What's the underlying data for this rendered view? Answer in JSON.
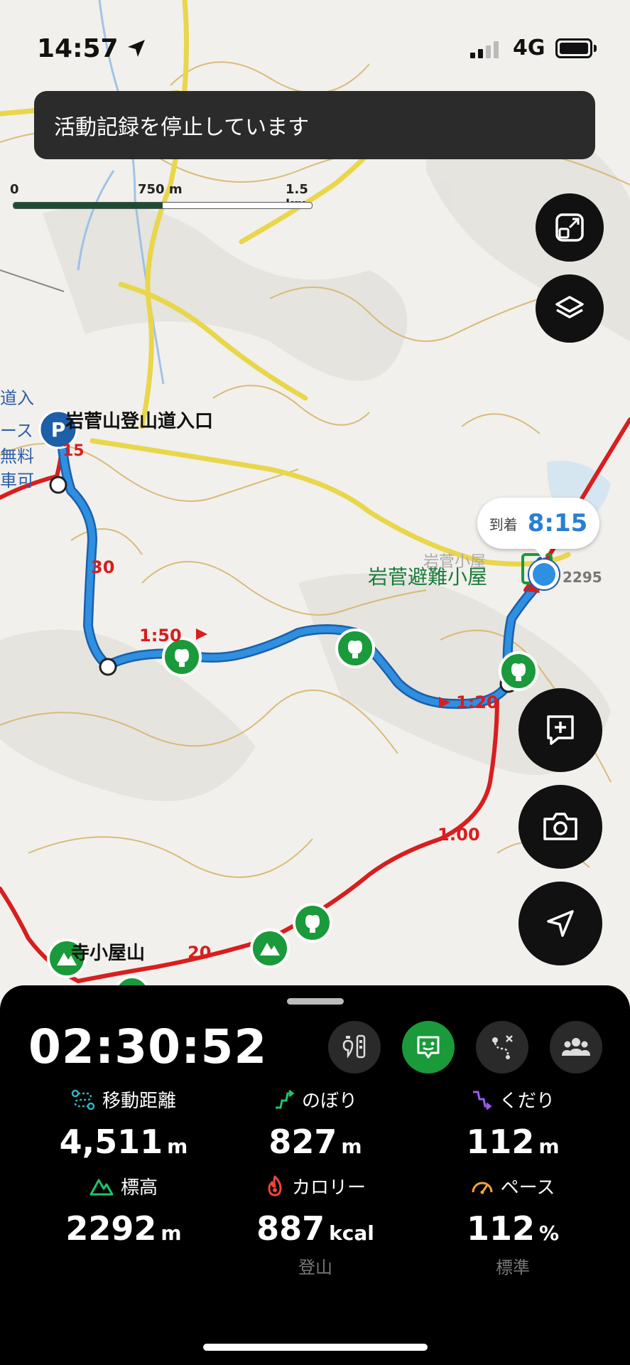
{
  "status_bar": {
    "time": "14:57",
    "network": "4G"
  },
  "toast": {
    "message": "活動記録を停止しています"
  },
  "scale": {
    "labels": [
      "0",
      "750 m",
      "1.5 km"
    ]
  },
  "map": {
    "labels": {
      "trailhead": "岩菅山登山道入口",
      "hut": "岩菅避難小屋",
      "peak": "寺小屋山",
      "elevation": "2295"
    },
    "route_numbers": [
      "15",
      "30",
      "1:50",
      "1:20",
      "1:00",
      "20"
    ],
    "side_text": [
      "道入",
      "ース",
      "無料",
      "車可"
    ],
    "partial_label": "岩菅小屋"
  },
  "arrival": {
    "label": "到着",
    "time": "8:15"
  },
  "panel": {
    "elapsed": "02:30:52",
    "stats": {
      "distance": {
        "label": "移動距離",
        "value": "4,511",
        "unit": "m"
      },
      "ascent": {
        "label": "のぼり",
        "value": "827",
        "unit": "m"
      },
      "descent": {
        "label": "くだり",
        "value": "112",
        "unit": "m"
      },
      "elevation": {
        "label": "標高",
        "value": "2292",
        "unit": "m"
      },
      "calories": {
        "label": "カロリー",
        "value": "887",
        "unit": "kcal",
        "sub": "登山"
      },
      "pace": {
        "label": "ペース",
        "value": "112",
        "unit": "%",
        "sub": "標準"
      }
    }
  },
  "colors": {
    "route_red": "#d81e1e",
    "track_blue": "#2f8fe0",
    "accent_green": "#1a9a3a",
    "toast_bg": "#2b2b2b"
  }
}
